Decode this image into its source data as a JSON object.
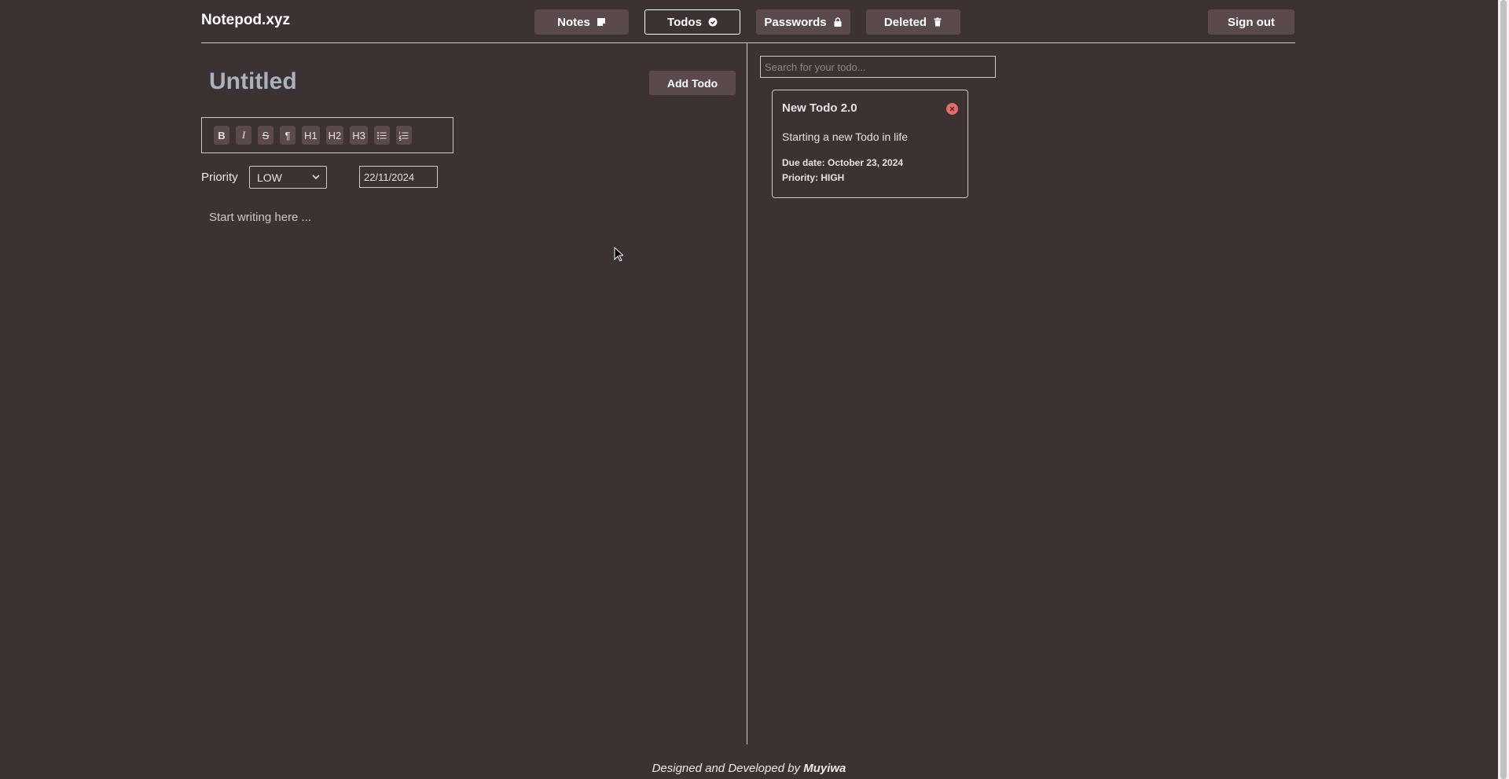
{
  "header": {
    "brand": "Notepod.xyz",
    "nav": [
      {
        "label": "Notes",
        "icon": "sticky-note-icon"
      },
      {
        "label": "Todos",
        "icon": "check-circle-icon"
      },
      {
        "label": "Passwords",
        "icon": "lock-icon"
      },
      {
        "label": "Deleted",
        "icon": "trash-icon"
      }
    ],
    "active_nav": "Todos",
    "sign_out": "Sign out"
  },
  "editor": {
    "title": "Untitled",
    "add_button": "Add Todo",
    "toolbar": {
      "bold": "B",
      "italic": "I",
      "strike": "S",
      "paragraph": "¶",
      "h1": "H1",
      "h2": "H2",
      "h3": "H3"
    },
    "priority_label": "Priority",
    "priority_value": "LOW",
    "date_value": "22/11/2024",
    "placeholder": "Start writing here ..."
  },
  "sidebar": {
    "search_placeholder": "Search for your todo...",
    "todos": [
      {
        "title": "New Todo 2.0",
        "body": "Starting a new Todo in life",
        "due": "Due date: October 23, 2024",
        "priority": "Priority: HIGH"
      }
    ]
  },
  "footer": {
    "text": "Designed and Developed by",
    "author": "Muyiwa"
  },
  "colors": {
    "background": "#3c3232",
    "button": "#5a4a4b",
    "close": "#e86a6a"
  }
}
